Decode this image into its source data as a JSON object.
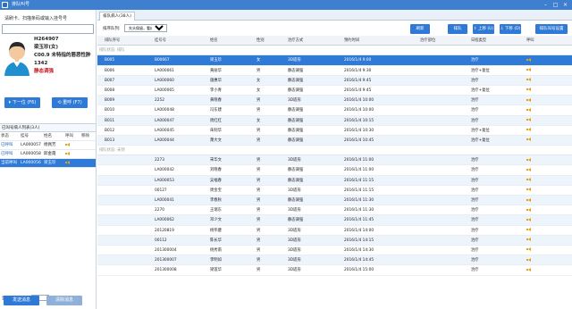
{
  "app": {
    "title": "排队叫号"
  },
  "left": {
    "hint": "请刷卡、扫描条码或输入挂号号",
    "patient": {
      "id": "H264907",
      "name": "梁玉珍(女)",
      "queue_line": "C00.9 未特指的唇恶性肿",
      "code": "1342",
      "status": "静态调强"
    },
    "buttons": {
      "next": "下一位 (F6)",
      "recall": "重呼 (F7)"
    },
    "called": {
      "caption": "已叫号病人列表(3人)",
      "columns": [
        "状态",
        "挂号",
        "姓名",
        "呼叫",
        "移除"
      ],
      "rows": [
        {
          "status": "已呼叫",
          "no": "LA000057",
          "name": "杨佩芳"
        },
        {
          "status": "已呼叫",
          "no": "LA000058",
          "name": "邱金霞"
        },
        {
          "status": "当前呼叫",
          "no": "LA000056",
          "name": "梁玉珍"
        }
      ]
    },
    "bottom": {
      "prefix": "显示最近呼叫的",
      "value": "5",
      "suffix": "个病人"
    },
    "footer": {
      "send": "发送消息",
      "clear": "清除消息"
    }
  },
  "right": {
    "tab": "排队病人(38人)",
    "toolbar": {
      "sort_label": "排序队列:",
      "sort_value": "先头保留，看床部",
      "refresh": "刷新",
      "queue": "排队",
      "up": "上移 (U)",
      "down": "下移 (D)",
      "settings": "排队叫号设置"
    },
    "columns": [
      "排队序号",
      "挂号号",
      "姓名",
      "性别",
      "治疗方式",
      "预约时间",
      "治疗部位",
      "日程类型",
      "呼叫"
    ],
    "groups": [
      {
        "label": "排队状态: 排队",
        "rows": [
          {
            "seq": "B005",
            "no": "B00667",
            "name": "梁玉珍",
            "sex": "女",
            "mode": "3D适形",
            "time": "2016/1/4 9:00",
            "part": "",
            "type": "治疗",
            "sel": true
          },
          {
            "seq": "B006",
            "no": "LA000061",
            "name": "黄丽华",
            "sex": "男",
            "mode": "静态调强",
            "time": "2016/1/4 9:30",
            "part": "",
            "type": "治疗+复位"
          },
          {
            "seq": "B007",
            "no": "LA000060",
            "name": "施惠华",
            "sex": "女",
            "mode": "静态调强",
            "time": "2016/1/4 9:45",
            "part": "",
            "type": "治疗"
          },
          {
            "seq": "B008",
            "no": "LA000065",
            "name": "李小青",
            "sex": "女",
            "mode": "静态调强",
            "time": "2016/1/4 9:45",
            "part": "",
            "type": "治疗+复位"
          },
          {
            "seq": "B009",
            "no": "2252",
            "name": "黄晓春",
            "sex": "男",
            "mode": "3D适形",
            "time": "2016/1/4 10:00",
            "part": "",
            "type": "治疗"
          },
          {
            "seq": "B010",
            "no": "LA000048",
            "name": "冯东建",
            "sex": "男",
            "mode": "静态调强",
            "time": "2016/1/4 10:00",
            "part": "",
            "type": "治疗"
          },
          {
            "seq": "B011",
            "no": "LA000047",
            "name": "周红红",
            "sex": "女",
            "mode": "静态调强",
            "time": "2016/1/4 10:15",
            "part": "",
            "type": "治疗"
          },
          {
            "seq": "B012",
            "no": "LA000045",
            "name": "朱钊华",
            "sex": "男",
            "mode": "静态调强",
            "time": "2016/1/4 10:30",
            "part": "",
            "type": "治疗+复位"
          },
          {
            "seq": "B013",
            "no": "LA000044",
            "name": "萧大文",
            "sex": "男",
            "mode": "静态调强",
            "time": "2016/1/4 10:45",
            "part": "",
            "type": "治疗+复位"
          }
        ]
      },
      {
        "label": "排队状态: 未到",
        "rows": [
          {
            "seq": "",
            "no": "2273",
            "name": "宋华文",
            "sex": "男",
            "mode": "3D适形",
            "time": "2016/1/4 11:00",
            "part": "",
            "type": "治疗"
          },
          {
            "seq": "",
            "no": "LA000042",
            "name": "刘晓春",
            "sex": "男",
            "mode": "静态调强",
            "time": "2016/1/4 11:00",
            "part": "",
            "type": "治疗"
          },
          {
            "seq": "",
            "no": "LA000053",
            "name": "吴福春",
            "sex": "男",
            "mode": "静态调强",
            "time": "2016/1/4 11:15",
            "part": "",
            "type": "治疗"
          },
          {
            "seq": "",
            "no": "00127",
            "name": "周金宝",
            "sex": "男",
            "mode": "3D适形",
            "time": "2016/1/4 11:15",
            "part": "",
            "type": "治疗"
          },
          {
            "seq": "",
            "no": "LA000041",
            "name": "李春秋",
            "sex": "男",
            "mode": "静态调强",
            "time": "2016/1/4 11:30",
            "part": "",
            "type": "治疗"
          },
          {
            "seq": "",
            "no": "2270",
            "name": "王瑞东",
            "sex": "男",
            "mode": "3D适形",
            "time": "2016/1/4 11:30",
            "part": "",
            "type": "治疗"
          },
          {
            "seq": "",
            "no": "LA000062",
            "name": "邓少文",
            "sex": "男",
            "mode": "静态调强",
            "time": "2016/1/4 11:45",
            "part": "",
            "type": "治疗"
          },
          {
            "seq": "",
            "no": "20120819",
            "name": "杨伟健",
            "sex": "男",
            "mode": "3D适形",
            "time": "2016/1/4 14:00",
            "part": "",
            "type": "治疗"
          },
          {
            "seq": "",
            "no": "00112",
            "name": "陈长华",
            "sex": "男",
            "mode": "3D适形",
            "time": "2016/1/4 14:15",
            "part": "",
            "type": "治疗"
          },
          {
            "seq": "",
            "no": "201300004",
            "name": "杨秀南",
            "sex": "男",
            "mode": "3D适形",
            "time": "2016/1/4 14:30",
            "part": "",
            "type": "治疗"
          },
          {
            "seq": "",
            "no": "201300007",
            "name": "李明如",
            "sex": "男",
            "mode": "3D适形",
            "time": "2016/1/4 14:45",
            "part": "",
            "type": "治疗"
          },
          {
            "seq": "",
            "no": "201300008",
            "name": "梁莲华",
            "sex": "男",
            "mode": "3D适形",
            "time": "2016/1/4 15:00",
            "part": "",
            "type": "治疗"
          }
        ]
      }
    ]
  }
}
